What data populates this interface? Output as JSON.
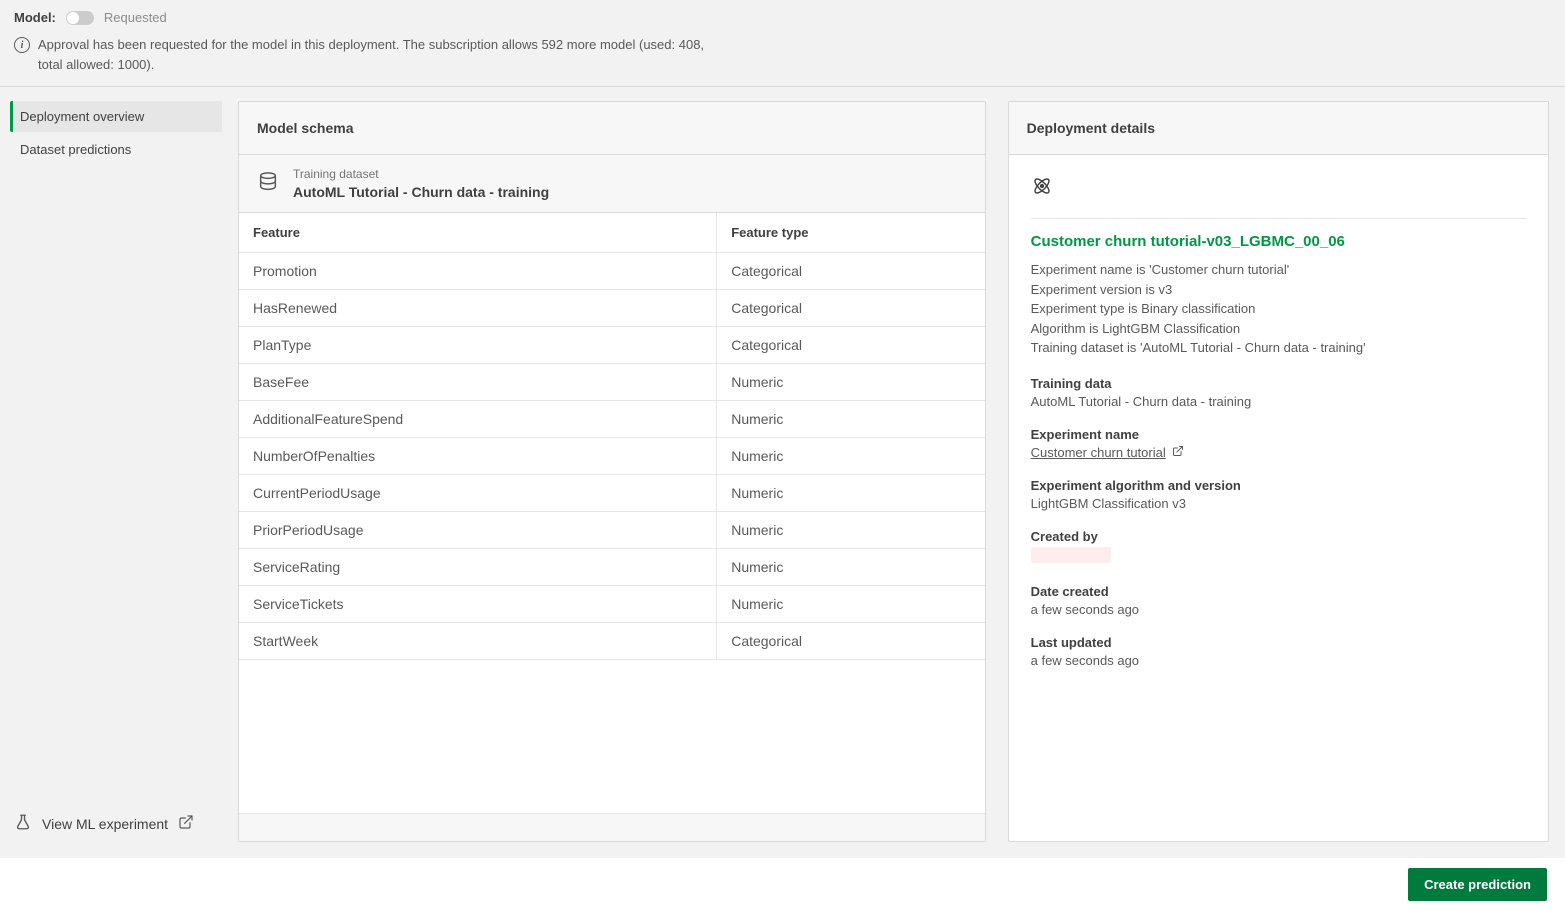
{
  "header": {
    "model_label": "Model:",
    "status": "Requested",
    "info_message": "Approval has been requested for the model in this deployment. The subscription allows 592 more model (used: 408, total allowed: 1000)."
  },
  "sidebar": {
    "items": [
      {
        "label": "Deployment overview",
        "active": true
      },
      {
        "label": "Dataset predictions",
        "active": false
      }
    ],
    "view_experiment": "View ML experiment"
  },
  "schema": {
    "title": "Model schema",
    "training_dataset_label": "Training dataset",
    "training_dataset_name": "AutoML Tutorial - Churn data - training",
    "columns": {
      "feature": "Feature",
      "type": "Feature type"
    },
    "rows": [
      {
        "feature": "Promotion",
        "type": "Categorical"
      },
      {
        "feature": "HasRenewed",
        "type": "Categorical"
      },
      {
        "feature": "PlanType",
        "type": "Categorical"
      },
      {
        "feature": "BaseFee",
        "type": "Numeric"
      },
      {
        "feature": "AdditionalFeatureSpend",
        "type": "Numeric"
      },
      {
        "feature": "NumberOfPenalties",
        "type": "Numeric"
      },
      {
        "feature": "CurrentPeriodUsage",
        "type": "Numeric"
      },
      {
        "feature": "PriorPeriodUsage",
        "type": "Numeric"
      },
      {
        "feature": "ServiceRating",
        "type": "Numeric"
      },
      {
        "feature": "ServiceTickets",
        "type": "Numeric"
      },
      {
        "feature": "StartWeek",
        "type": "Categorical"
      }
    ]
  },
  "details": {
    "title": "Deployment details",
    "model_title": "Customer churn tutorial-v03_LGBMC_00_06",
    "description": [
      "Experiment name is 'Customer churn tutorial'",
      "Experiment version is v3",
      "Experiment type is Binary classification",
      "Algorithm is LightGBM Classification",
      "Training dataset is 'AutoML Tutorial - Churn data - training'"
    ],
    "training_data_k": "Training data",
    "training_data_v": "AutoML Tutorial - Churn data - training",
    "experiment_name_k": "Experiment name",
    "experiment_name_v": "Customer churn tutorial",
    "algo_k": "Experiment algorithm and version",
    "algo_v": "LightGBM Classification v3",
    "created_by_k": "Created by",
    "date_created_k": "Date created",
    "date_created_v": "a few seconds ago",
    "last_updated_k": "Last updated",
    "last_updated_v": "a few seconds ago"
  },
  "footer": {
    "create_button": "Create prediction"
  }
}
